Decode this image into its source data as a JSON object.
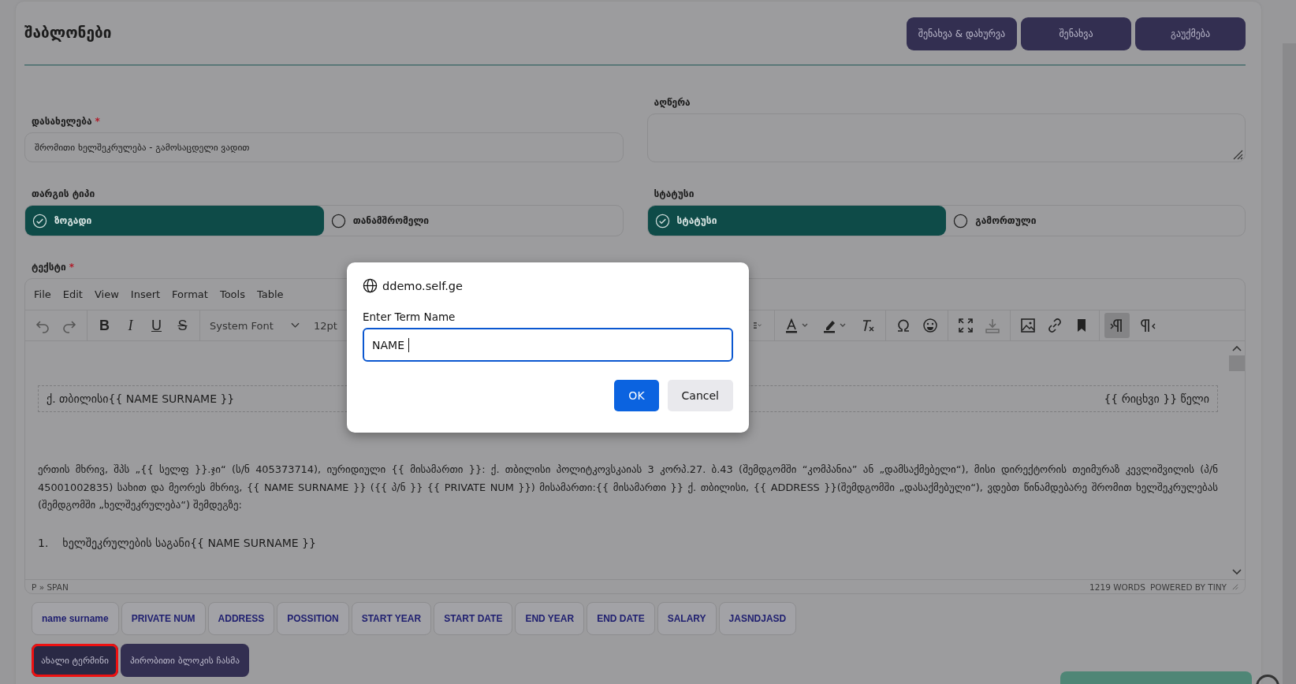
{
  "page_title": "შაბლონები",
  "header_buttons": [
    "შენახვა & დახურვა",
    "შენახვა",
    "გაუქმება"
  ],
  "name_field": {
    "label": "დასახელება",
    "required_mark": "*",
    "value": "შრომითი ხელშეკრულება - გამოსაცდელი ვადით"
  },
  "description_field": {
    "label": "აღწერა"
  },
  "template_type": {
    "label": "თარგის ტიპი",
    "options": [
      {
        "label": "ზოგადი",
        "selected": true
      },
      {
        "label": "თანამშრომელი",
        "selected": false
      }
    ]
  },
  "status": {
    "label": "სტატუსი",
    "options": [
      {
        "label": "სტატუსი",
        "selected": true
      },
      {
        "label": "გამორთული",
        "selected": false
      }
    ]
  },
  "editor": {
    "label": "ტექსტი",
    "required_mark": "*",
    "menu": [
      "File",
      "Edit",
      "View",
      "Insert",
      "Format",
      "Tools",
      "Table"
    ],
    "format_buttons": [
      {
        "text": "B",
        "kind": "bold"
      },
      {
        "text": "I",
        "kind": "italic"
      },
      {
        "text": "U",
        "kind": "underline"
      },
      {
        "text": "S",
        "kind": "strike"
      }
    ],
    "font": "System Font",
    "size": "12pt",
    "direction_toggles": [
      {
        "selected": true
      },
      {
        "selected": false
      }
    ],
    "header_left": "ქ. თბილისი{{ NAME SURNAME }}",
    "header_right": "{{ რიცხვი }} წელი",
    "paragraph": "ერთის მხრივ, შპს „{{ სელფ }}.ჯი“ (ს/ნ 405373714), იურიდიული {{ მისამართი }}: ქ. თბილისი პოლიტკოვსკაიას 3 კორპ.27. ბ.43 (შემდგომში “კომპანია” ან „დამსაქმებელი“), მისი დირექტორის თეიმურაზ კევლიშვილის (პ/ნ 45001002835) სახით და მეორეს მხრივ, {{ NAME SURNAME }} ({{ პ/ნ }} {{ PRIVATE NUM }}) მისამართი:{{ მისამართი }} ქ. თბილისი, {{ ADDRESS }}(შემდგომში „დასაქმებული“), ვდებთ წინამდებარე შრომით ხელშეკრულებას  (შემდგომში „ხელშეკრულება“) შემდეგზე:",
    "list_item": {
      "number": "1.",
      "text": "ხელშეკრულების საგანი{{ NAME SURNAME }}"
    },
    "path": "P » SPAN",
    "word_count": "1219 WORDS",
    "powered": "POWERED BY TINY"
  },
  "term_chips": [
    "name surname",
    "PRIVATE NUM",
    "ADDRESS",
    "POSSITION",
    "START YEAR",
    "START DATE",
    "END YEAR",
    "END DATE",
    "SALARY",
    "JASNDJASD"
  ],
  "action_buttons": [
    {
      "label": "ახალი ტერმინი",
      "focused": true
    },
    {
      "label": "პირობითი ბლოკის ჩასმა",
      "focused": false
    }
  ],
  "dialog": {
    "origin": "ddemo.self.ge",
    "label": "Enter Term Name",
    "value": "NAME",
    "buttons": [
      {
        "label": "OK",
        "kind": "primary"
      },
      {
        "label": "Cancel",
        "kind": "secondary"
      }
    ]
  }
}
